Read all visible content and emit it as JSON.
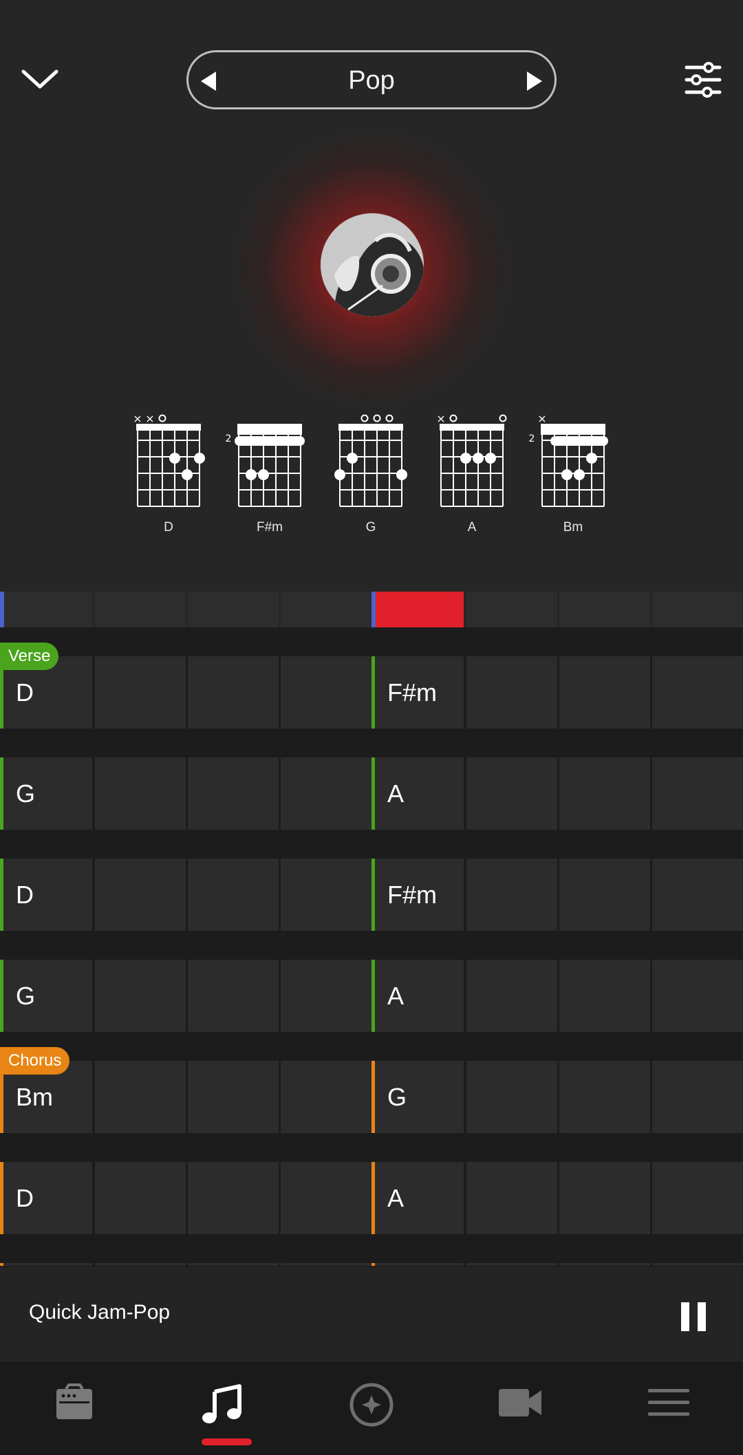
{
  "header": {
    "collapse_icon": "chevron-down-icon",
    "genre": "Pop",
    "prev_icon": "triangle-left-icon",
    "next_icon": "triangle-right-icon",
    "settings_icon": "sliders-icon"
  },
  "chords": [
    {
      "name": "D",
      "fret_label": ""
    },
    {
      "name": "F#m",
      "fret_label": "2"
    },
    {
      "name": "G",
      "fret_label": ""
    },
    {
      "name": "A",
      "fret_label": ""
    },
    {
      "name": "Bm",
      "fret_label": "2"
    }
  ],
  "timeline": {
    "active_index": 4,
    "cells": 8
  },
  "sections": {
    "verse": {
      "label": "Verse",
      "color": "#4aa41c"
    },
    "chorus": {
      "label": "Chorus",
      "color": "#e88514"
    }
  },
  "grid": {
    "rows": [
      {
        "section": "verse",
        "tag": "Verse",
        "left": "D",
        "right": "F#m"
      },
      {
        "section": "verse",
        "tag": "",
        "left": "G",
        "right": "A"
      },
      {
        "section": "verse",
        "tag": "",
        "left": "D",
        "right": "F#m"
      },
      {
        "section": "verse",
        "tag": "",
        "left": "G",
        "right": "A"
      },
      {
        "section": "chorus",
        "tag": "Chorus",
        "left": "Bm",
        "right": "G"
      },
      {
        "section": "chorus",
        "tag": "",
        "left": "D",
        "right": "A"
      }
    ]
  },
  "player": {
    "title": "Quick Jam-Pop",
    "pause_icon": "pause-icon"
  },
  "nav": {
    "items": [
      {
        "icon": "amp-icon",
        "active": false
      },
      {
        "icon": "music-note-icon",
        "active": true
      },
      {
        "icon": "compass-icon",
        "active": false
      },
      {
        "icon": "video-camera-icon",
        "active": false
      },
      {
        "icon": "menu-icon",
        "active": false
      }
    ]
  },
  "colors": {
    "accent_red": "#e0202a",
    "verse_green": "#4aa41c",
    "chorus_orange": "#e88514",
    "timeline_marker": "#4a62c9"
  }
}
